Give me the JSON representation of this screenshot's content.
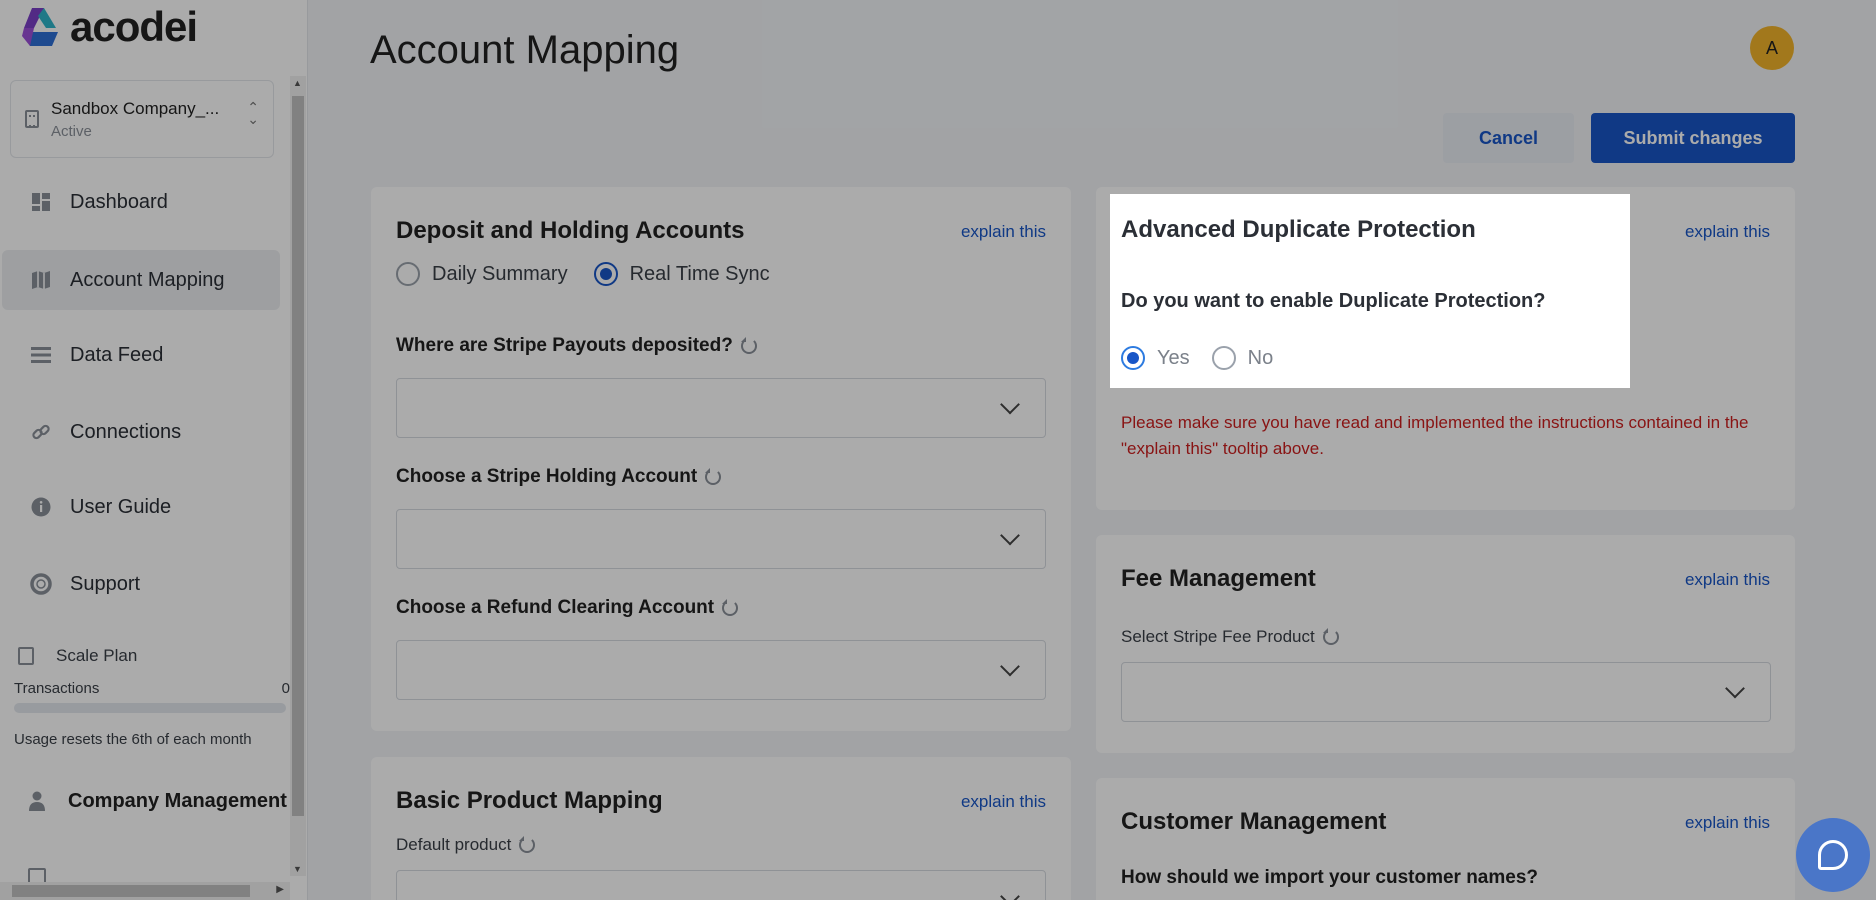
{
  "app": {
    "logo_text": "acodei"
  },
  "company": {
    "name": "Sandbox Company_...",
    "status": "Active"
  },
  "nav": [
    {
      "label": "Dashboard",
      "icon": "dashboard-icon"
    },
    {
      "label": "Account Mapping",
      "icon": "map-icon"
    },
    {
      "label": "Data Feed",
      "icon": "list-icon"
    },
    {
      "label": "Connections",
      "icon": "link-icon"
    },
    {
      "label": "User Guide",
      "icon": "info-icon"
    },
    {
      "label": "Support",
      "icon": "lifebuoy-icon"
    }
  ],
  "plan": {
    "name": "Scale Plan",
    "metric_label": "Transactions",
    "metric_value": "0",
    "usage_fraction": 0,
    "note": "Usage resets the 6th of each month"
  },
  "company_management": {
    "label": "Company Management"
  },
  "header": {
    "title": "Account Mapping",
    "avatar_initial": "A",
    "cancel_label": "Cancel",
    "submit_label": "Submit changes"
  },
  "deposit": {
    "title": "Deposit and Holding Accounts",
    "explain": "explain this",
    "options": [
      "Daily Summary",
      "Real Time Sync"
    ],
    "selected": "Real Time Sync",
    "fields": [
      {
        "label": "Where are Stripe Payouts deposited?",
        "value": ""
      },
      {
        "label": "Choose a Stripe Holding Account",
        "value": ""
      },
      {
        "label": "Choose a Refund Clearing Account",
        "value": ""
      }
    ]
  },
  "basic_product": {
    "title": "Basic Product Mapping",
    "explain": "explain this",
    "field_label": "Default product"
  },
  "duplicate": {
    "title": "Advanced Duplicate Protection",
    "explain": "explain this",
    "question": "Do you want to enable Duplicate Protection?",
    "options": [
      "Yes",
      "No"
    ],
    "selected": "Yes",
    "warning": "Please make sure you have read and implemented the instructions contained in the \"explain this\" tooltip above."
  },
  "fee": {
    "title": "Fee Management",
    "explain": "explain this",
    "field_label": "Select Stripe Fee Product"
  },
  "customer": {
    "title": "Customer Management",
    "explain": "explain this",
    "question": "How should we import your customer names?"
  },
  "colors": {
    "accent": "#1856c7",
    "warning": "#cc1f1f",
    "avatar": "#f2b32a"
  }
}
